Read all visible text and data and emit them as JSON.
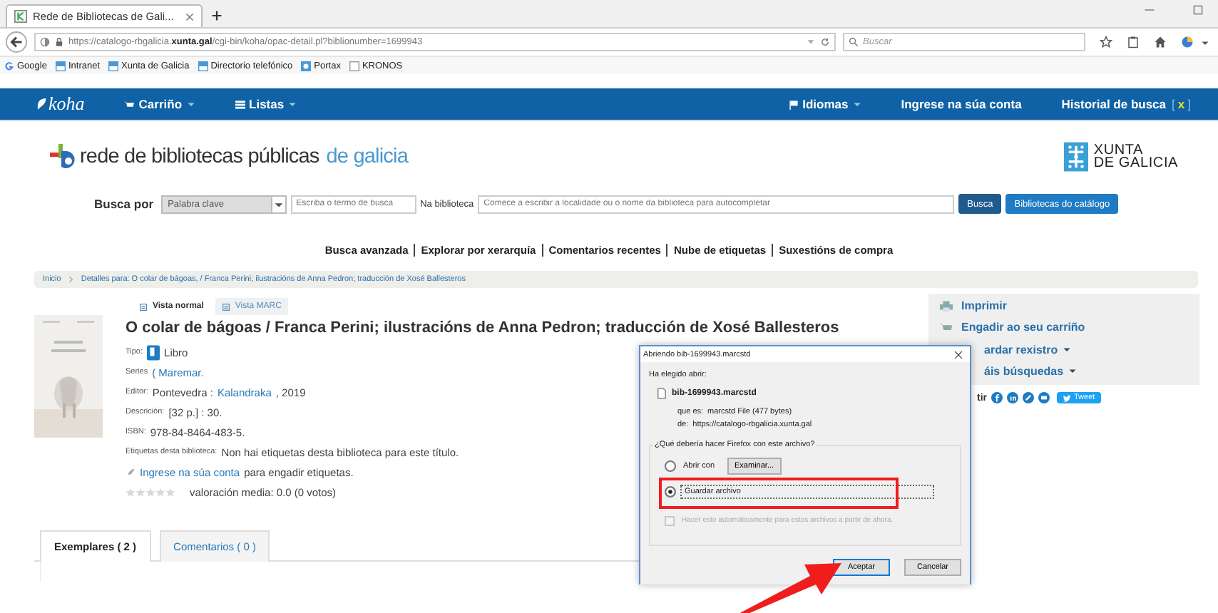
{
  "browser": {
    "tab_title": "Rede de Bibliotecas de Gali...",
    "url": "https://catalogo-rbgalicia.**xunta.gal**/cgi-bin/koha/opac-detail.pl?biblionumber=1699943",
    "search_placeholder": "Buscar",
    "bookmarks": [
      {
        "label": "Google",
        "kind": "google"
      },
      {
        "label": "Intranet",
        "kind": "site"
      },
      {
        "label": "Xunta de Galicia",
        "kind": "site"
      },
      {
        "label": "Directorio telefónico",
        "kind": "site"
      },
      {
        "label": "Portax",
        "kind": "app"
      },
      {
        "label": "KRONOS",
        "kind": "page"
      }
    ]
  },
  "navbar": {
    "logo": "koha",
    "menus": [
      {
        "label": "Carriño",
        "kind": "cart"
      },
      {
        "label": "Listas",
        "kind": "list"
      }
    ],
    "languages": "Idiomas",
    "login": "Ingrese na súa conta",
    "history": "Historial de busca",
    "history_clear": {
      "open": "[",
      "mark": "x",
      "close": "]"
    }
  },
  "header": {
    "logo_main": "rede de bibliotecas públicas",
    "logo_accent": "de galicia",
    "xunta": [
      "XUNTA",
      "DE GALICIA"
    ]
  },
  "search": {
    "label": "Busca por",
    "type": "Palabra clave",
    "term_placeholder": "Escriba o termo de busca",
    "library_label": "Na biblioteca",
    "library_placeholder": "Comece a escribir a localidade ou o nome da biblioteca para autocompletar",
    "buttons": [
      "Busca",
      "Bibliotecas do catálogo"
    ]
  },
  "links": [
    "Busca avanzada",
    "Explorar por xerarquía",
    "Comentarios recentes",
    "Nube de etiquetas",
    "Suxestións de compra"
  ],
  "breadcrumb": [
    "Inicio",
    "Detalles para: O colar de bágoas, / Franca Perini; ilustracións de Anna Pedron; traducción de Xosé Ballesteros"
  ],
  "views": [
    {
      "label": "Vista normal",
      "selected": true
    },
    {
      "label": "Vista MARC",
      "selected": false
    }
  ],
  "record": {
    "title": "O colar de bágoas / Franca Perini; ilustracións de Anna Pedron; traducción de Xosé Ballesteros",
    "type_label": "Tipo:",
    "type": "Libro",
    "series_label": "Series",
    "series": "( Maremar.",
    "editor_label": "Editor:",
    "editor_place": "Pontevedra :",
    "editor_name": "Kalandraka",
    "editor_year": ", 2019",
    "description_label": "Descrición:",
    "description": "[32 p.] : 30.",
    "isbn_label": "ISBN:",
    "isbn": "978-84-8464-483-5.",
    "tags_label": "Etiquetas desta biblioteca:",
    "tags": "Non hai etiquetas desta biblioteca para este título.",
    "tags_login": "Ingrese na súa conta",
    "tags_hint": "para engadir etiquetas.",
    "rating": {
      "stars": 0,
      "text": "valoración media: 0.0 (0 votos)"
    }
  },
  "record_tabs": [
    {
      "label": "Exemplares ( 2 )",
      "selected": true
    },
    {
      "label": "Comentarios ( 0 )",
      "selected": false
    }
  ],
  "actions": [
    {
      "label": "Imprimir",
      "kind": "print"
    },
    {
      "label": "Engadir ao seu carriño",
      "kind": "cart"
    },
    {
      "label": "ardar rexistro",
      "kind": "menu"
    },
    {
      "label": "áis búsquedas",
      "kind": "menu"
    }
  ],
  "share": {
    "label": "tir",
    "tweet": "Tweet"
  },
  "dialog": {
    "title": "Abriendo bib-1699943.marcstd",
    "intro": "Ha elegido abrir:",
    "file": "bib-1699943.marcstd",
    "type_label": "que es:",
    "type": "marcstd File (477 bytes)",
    "from_label": "de:",
    "from": "https://catalogo-rbgalicia.xunta.gal",
    "question": "¿Qué debería hacer Firefox con este archivo?",
    "options": [
      {
        "label": "Abrir con",
        "selected": false
      },
      {
        "label": "Guardar archivo",
        "selected": true
      }
    ],
    "browse": "Examinar...",
    "remember": {
      "label": "Hacer esto automáticamente para estos archivos a partir de ahora.",
      "checked": false,
      "disabled": true
    },
    "buttons": [
      "Aceptar",
      "Cancelar"
    ]
  }
}
